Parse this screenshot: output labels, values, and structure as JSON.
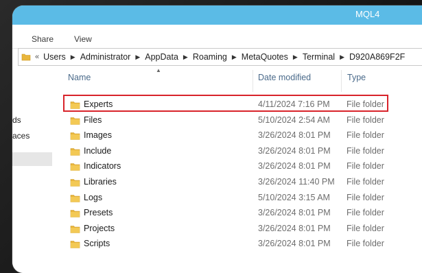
{
  "window": {
    "title": "MQL4"
  },
  "ribbon": {
    "tabs": [
      "Share",
      "View"
    ]
  },
  "address": {
    "overflow": "«",
    "crumbs": [
      "Users",
      "Administrator",
      "AppData",
      "Roaming",
      "MetaQuotes",
      "Terminal",
      "D920A869F2F"
    ]
  },
  "navpane": {
    "items": [
      "ds",
      "aces"
    ]
  },
  "columns": {
    "name": "Name",
    "date": "Date modified",
    "type": "Type"
  },
  "files": [
    {
      "name": "Experts",
      "date": "4/11/2024 7:16 PM",
      "type": "File folder"
    },
    {
      "name": "Files",
      "date": "5/10/2024 2:54 AM",
      "type": "File folder"
    },
    {
      "name": "Images",
      "date": "3/26/2024 8:01 PM",
      "type": "File folder"
    },
    {
      "name": "Include",
      "date": "3/26/2024 8:01 PM",
      "type": "File folder"
    },
    {
      "name": "Indicators",
      "date": "3/26/2024 8:01 PM",
      "type": "File folder"
    },
    {
      "name": "Libraries",
      "date": "3/26/2024 11:40 PM",
      "type": "File folder"
    },
    {
      "name": "Logs",
      "date": "5/10/2024 3:15 AM",
      "type": "File folder"
    },
    {
      "name": "Presets",
      "date": "3/26/2024 8:01 PM",
      "type": "File folder"
    },
    {
      "name": "Projects",
      "date": "3/26/2024 8:01 PM",
      "type": "File folder"
    },
    {
      "name": "Scripts",
      "date": "3/26/2024 8:01 PM",
      "type": "File folder"
    }
  ],
  "colors": {
    "titlebar": "#5bbbe6",
    "highlight": "#d8232a",
    "folder": "#e9b63c"
  },
  "icons": {
    "folder": "folder-icon",
    "breadcrumb_separator": "chevron-right-icon",
    "sort": "sort-ascending-icon"
  }
}
